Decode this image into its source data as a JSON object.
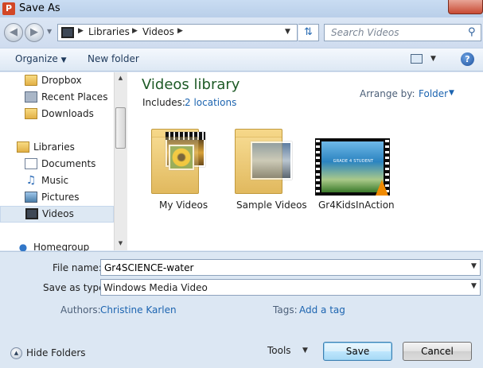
{
  "window": {
    "title": "Save As",
    "app_icon_letter": "P"
  },
  "address": {
    "breadcrumb": [
      "Libraries",
      "Videos"
    ],
    "search_placeholder": "Search Videos"
  },
  "toolbar": {
    "organize_label": "Organize",
    "new_folder_label": "New folder"
  },
  "nav": {
    "items": [
      {
        "label": "Dropbox",
        "icon": "folder-icon"
      },
      {
        "label": "Recent Places",
        "icon": "recent-places-icon"
      },
      {
        "label": "Downloads",
        "icon": "downloads-icon"
      },
      {
        "label": "Libraries",
        "icon": "libraries-icon"
      },
      {
        "label": "Documents",
        "icon": "documents-icon"
      },
      {
        "label": "Music",
        "icon": "music-icon"
      },
      {
        "label": "Pictures",
        "icon": "pictures-icon"
      },
      {
        "label": "Videos",
        "icon": "videos-icon",
        "selected": true
      },
      {
        "label": "Homegroup",
        "icon": "homegroup-icon"
      }
    ]
  },
  "library": {
    "title": "Videos library",
    "includes_label": "Includes:",
    "includes_link": "2 locations",
    "arrange_label": "Arrange by:",
    "arrange_value": "Folder"
  },
  "files": [
    {
      "label": "My Videos",
      "type": "folder"
    },
    {
      "label": "Sample Videos",
      "type": "folder"
    },
    {
      "label": "Gr4KidsInAction",
      "type": "video"
    }
  ],
  "video_thumb_caption": "GRADE 4 STUDENT",
  "form": {
    "filename_label": "File name:",
    "filename_value": "Gr4SCIENCE-water",
    "saveas_label": "Save as type:",
    "saveas_value": "Windows Media Video",
    "authors_label": "Authors:",
    "authors_value": "Christine Karlen",
    "tags_label": "Tags:",
    "tags_value": "Add a tag"
  },
  "footer": {
    "hide_folders_label": "Hide Folders",
    "tools_label": "Tools",
    "save_label": "Save",
    "cancel_label": "Cancel"
  },
  "colors": {
    "accent_link": "#1c64b0",
    "library_title": "#1e5a26"
  }
}
